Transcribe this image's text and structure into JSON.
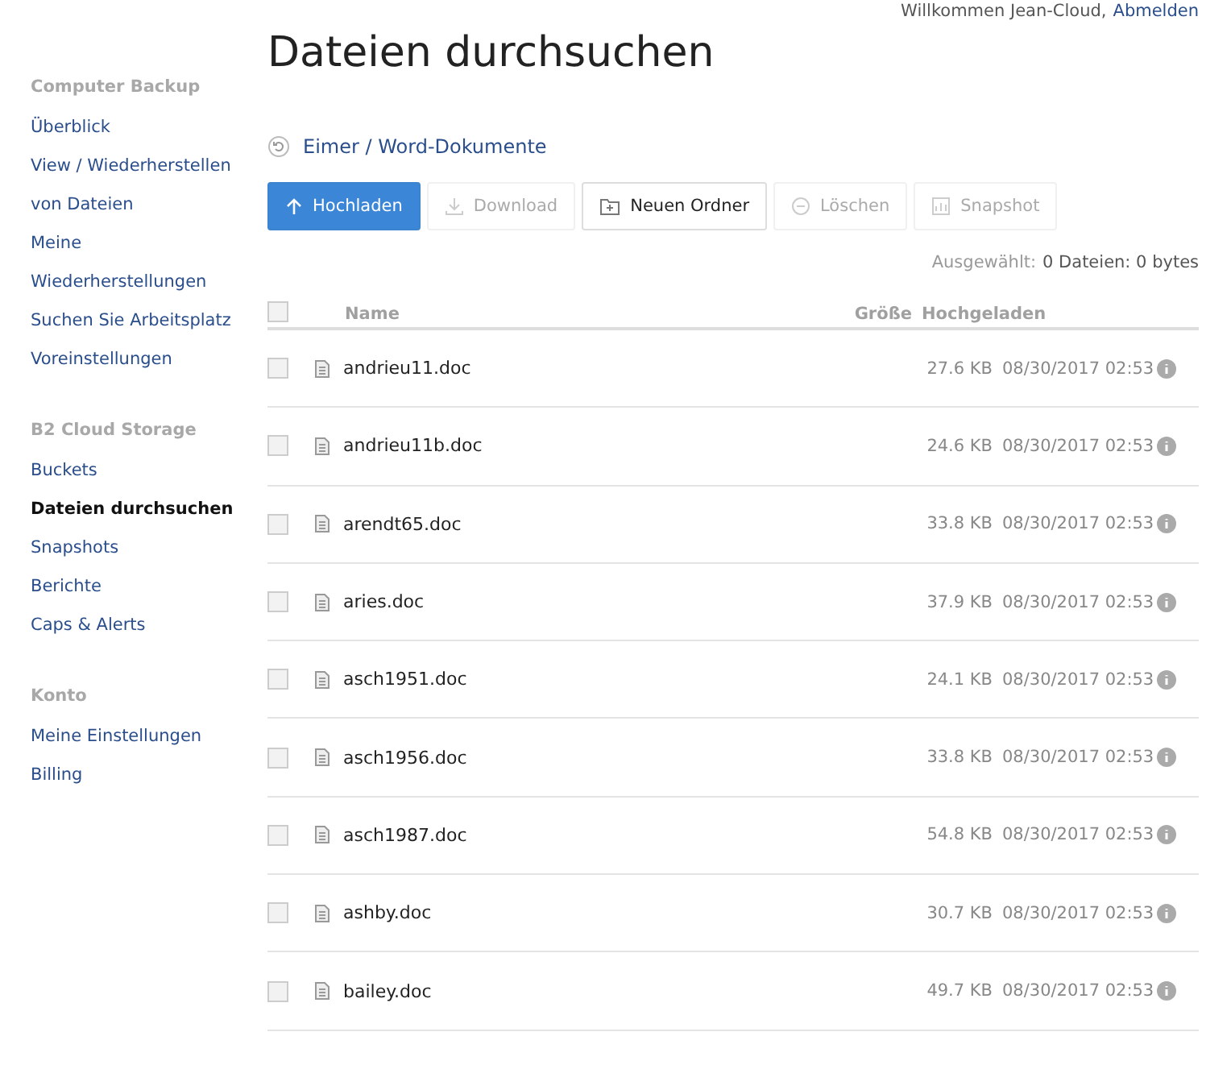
{
  "header": {
    "greeting": "Willkommen Jean-Cloud,",
    "logout": "Abmelden"
  },
  "sidebar": {
    "sections": [
      {
        "heading": "Computer Backup",
        "items": [
          {
            "label": "Überblick",
            "selected": false
          },
          {
            "label": "View / Wiederherstellen",
            "selected": false
          },
          {
            "label": "von Dateien",
            "selected": false
          },
          {
            "label": "Meine",
            "selected": false
          },
          {
            "label": "Wiederherstellungen",
            "selected": false
          },
          {
            "label": "Suchen Sie Arbeitsplatz",
            "selected": false
          },
          {
            "label": "Voreinstellungen",
            "selected": false
          }
        ]
      },
      {
        "heading": "B2 Cloud Storage",
        "items": [
          {
            "label": "Buckets",
            "selected": false
          },
          {
            "label": "Dateien durchsuchen",
            "selected": true
          },
          {
            "label": "Snapshots",
            "selected": false
          },
          {
            "label": "Berichte",
            "selected": false
          },
          {
            "label": "Caps & Alerts",
            "selected": false
          }
        ]
      },
      {
        "heading": "Konto",
        "items": [
          {
            "label": "Meine Einstellungen",
            "selected": false
          },
          {
            "label": "Billing",
            "selected": false
          }
        ]
      }
    ]
  },
  "page_title": "Dateien durchsuchen",
  "breadcrumb": "Eimer / Word-Dokumente",
  "toolbar": [
    {
      "label": "Hochladen",
      "kind": "upload",
      "primary": true,
      "disabled": false
    },
    {
      "label": "Download",
      "kind": "download",
      "primary": false,
      "disabled": true
    },
    {
      "label": "Neuen Ordner",
      "kind": "folder",
      "primary": false,
      "disabled": false
    },
    {
      "label": "Löschen",
      "kind": "delete",
      "primary": false,
      "disabled": true
    },
    {
      "label": "Snapshot",
      "kind": "snapshot",
      "primary": false,
      "disabled": true
    }
  ],
  "selection_summary": {
    "label": "Ausgewählt:",
    "value": "0 Dateien: 0 bytes"
  },
  "table": {
    "select_all_checked": false,
    "columns": [
      "Name",
      "Größe",
      "Hochgeladen"
    ],
    "rows": [
      {
        "name": "andrieu11.doc",
        "size": "27.6 KB",
        "uploaded": "08/30/2017 02:53",
        "checked": false
      },
      {
        "name": "andrieu11b.doc",
        "size": "24.6 KB",
        "uploaded": "08/30/2017 02:53",
        "checked": false
      },
      {
        "name": "arendt65.doc",
        "size": "33.8 KB",
        "uploaded": "08/30/2017 02:53",
        "checked": false
      },
      {
        "name": "aries.doc",
        "size": "37.9 KB",
        "uploaded": "08/30/2017 02:53",
        "checked": false
      },
      {
        "name": "asch1951.doc",
        "size": "24.1 KB",
        "uploaded": "08/30/2017 02:53",
        "checked": false
      },
      {
        "name": "asch1956.doc",
        "size": "33.8 KB",
        "uploaded": "08/30/2017 02:53",
        "checked": false
      },
      {
        "name": "asch1987.doc",
        "size": "54.8 KB",
        "uploaded": "08/30/2017 02:53",
        "checked": false
      },
      {
        "name": "ashby.doc",
        "size": "30.7 KB",
        "uploaded": "08/30/2017 02:53",
        "checked": false
      },
      {
        "name": "bailey.doc",
        "size": "49.7 KB",
        "uploaded": "08/30/2017 02:53",
        "checked": false
      }
    ]
  }
}
